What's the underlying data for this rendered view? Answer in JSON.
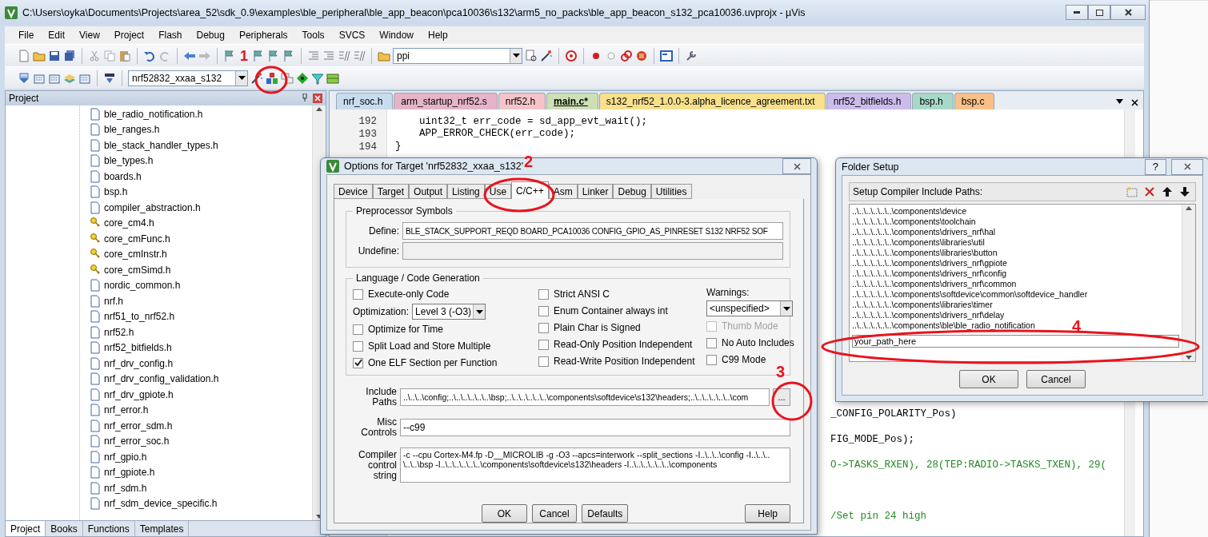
{
  "window": {
    "title": "C:\\Users\\oyka\\Documents\\Projects\\area_52\\sdk_0.9\\examples\\ble_peripheral\\ble_app_beacon\\pca10036\\s132\\arm5_no_packs\\ble_app_beacon_s132_pca10036.uvprojx - µVis"
  },
  "menu": [
    "File",
    "Edit",
    "View",
    "Project",
    "Flash",
    "Debug",
    "Peripherals",
    "Tools",
    "SVCS",
    "Window",
    "Help"
  ],
  "toolbar": {
    "find_combo": "ppi",
    "target_combo": "nrf52832_xxaa_s132"
  },
  "project_panel": {
    "title": "Project",
    "files": [
      {
        "name": "ble_radio_notification.h",
        "kind": "file"
      },
      {
        "name": "ble_ranges.h",
        "kind": "file"
      },
      {
        "name": "ble_stack_handler_types.h",
        "kind": "file"
      },
      {
        "name": "ble_types.h",
        "kind": "file"
      },
      {
        "name": "boards.h",
        "kind": "file"
      },
      {
        "name": "bsp.h",
        "kind": "file"
      },
      {
        "name": "compiler_abstraction.h",
        "kind": "file"
      },
      {
        "name": "core_cm4.h",
        "kind": "key"
      },
      {
        "name": "core_cmFunc.h",
        "kind": "key"
      },
      {
        "name": "core_cmInstr.h",
        "kind": "key"
      },
      {
        "name": "core_cmSimd.h",
        "kind": "key"
      },
      {
        "name": "nordic_common.h",
        "kind": "file"
      },
      {
        "name": "nrf.h",
        "kind": "file"
      },
      {
        "name": "nrf51_to_nrf52.h",
        "kind": "file"
      },
      {
        "name": "nrf52.h",
        "kind": "file"
      },
      {
        "name": "nrf52_bitfields.h",
        "kind": "file"
      },
      {
        "name": "nrf_drv_config.h",
        "kind": "file"
      },
      {
        "name": "nrf_drv_config_validation.h",
        "kind": "file"
      },
      {
        "name": "nrf_drv_gpiote.h",
        "kind": "file"
      },
      {
        "name": "nrf_error.h",
        "kind": "file"
      },
      {
        "name": "nrf_error_sdm.h",
        "kind": "file"
      },
      {
        "name": "nrf_error_soc.h",
        "kind": "file"
      },
      {
        "name": "nrf_gpio.h",
        "kind": "file"
      },
      {
        "name": "nrf_gpiote.h",
        "kind": "file"
      },
      {
        "name": "nrf_sdm.h",
        "kind": "file"
      },
      {
        "name": "nrf_sdm_device_specific.h",
        "kind": "file"
      }
    ],
    "tabs": [
      {
        "label": "Project",
        "selected": true
      },
      {
        "label": "Books",
        "selected": false
      },
      {
        "label": "Functions",
        "selected": false
      },
      {
        "label": "Templates",
        "selected": false
      }
    ]
  },
  "editor": {
    "tabs": [
      {
        "label": "nrf_soc.h",
        "selected": false,
        "color": "#c8dcf0"
      },
      {
        "label": "arm_startup_nrf52.s",
        "selected": false,
        "color": "#e6b4c8"
      },
      {
        "label": "nrf52.h",
        "selected": false,
        "color": "#f4c4c8"
      },
      {
        "label": "main.c*",
        "selected": true,
        "color": "#cce0b4"
      },
      {
        "label": "s132_nrf52_1.0.0-3.alpha_licence_agreement.txt",
        "selected": false,
        "color": "#f8e08c"
      },
      {
        "label": "nrf52_bitfields.h",
        "selected": false,
        "color": "#ccbcec"
      },
      {
        "label": "bsp.h",
        "selected": false,
        "color": "#a8d8c8"
      },
      {
        "label": "bsp.c",
        "selected": false,
        "color": "#f8c088"
      }
    ],
    "lines": [
      {
        "number": "192",
        "text": "    uint32_t err_code = sd_app_evt_wait();"
      },
      {
        "number": "193",
        "text": "    APP_ERROR_CHECK(err_code);"
      },
      {
        "number": "194",
        "text": "}"
      }
    ],
    "fragments": [
      {
        "text": "_CONFIG_POLARITY_Pos)",
        "kind": "code"
      },
      {
        "text": "FIG_MODE_Pos);",
        "kind": "code"
      },
      {
        "text": "O->TASKS_RXEN), 28(TEP:RADIO->TASKS_TXEN), 29(",
        "kind": "comment"
      },
      {
        "text": "/Set pin 24 high",
        "kind": "comment"
      }
    ]
  },
  "options_dialog": {
    "title": "Options for Target 'nrf52832_xxaa_s132'",
    "tabs": [
      {
        "label": "Device",
        "selected": false
      },
      {
        "label": "Target",
        "selected": false
      },
      {
        "label": "Output",
        "selected": false
      },
      {
        "label": "Listing",
        "selected": false
      },
      {
        "label": "Use",
        "selected": false
      },
      {
        "label": "C/C++",
        "selected": true
      },
      {
        "label": "Asm",
        "selected": false
      },
      {
        "label": "Linker",
        "selected": false
      },
      {
        "label": "Debug",
        "selected": false
      },
      {
        "label": "Utilities",
        "selected": false
      }
    ],
    "preprocessor": {
      "title": "Preprocessor Symbols",
      "define_label": "Define:",
      "define": "BLE_STACK_SUPPORT_REQD BOARD_PCA10036 CONFIG_GPIO_AS_PINRESET S132 NRF52 SOF",
      "undefine_label": "Undefine:"
    },
    "language": {
      "title": "Language / Code Generation",
      "column_1": [
        {
          "kind": "check",
          "label": "Execute-only Code",
          "checked": false,
          "disabled": false
        },
        {
          "kind": "select",
          "label": "Optimization:",
          "value": "Level 3 (-O3)"
        },
        {
          "kind": "check",
          "label": "Optimize for Time",
          "checked": false,
          "disabled": false
        },
        {
          "kind": "check",
          "label": "Split Load and Store Multiple",
          "checked": false,
          "disabled": false
        },
        {
          "kind": "check",
          "label": "One ELF Section per Function",
          "checked": true,
          "disabled": false
        }
      ],
      "column_2": [
        {
          "kind": "check",
          "label": "Strict ANSI C",
          "checked": false,
          "disabled": false
        },
        {
          "kind": "check",
          "label": "Enum Container always int",
          "checked": false,
          "disabled": false
        },
        {
          "kind": "check",
          "label": "Plain Char is Signed",
          "checked": false,
          "disabled": false
        },
        {
          "kind": "check",
          "label": "Read-Only Position Independent",
          "checked": false,
          "disabled": false
        },
        {
          "kind": "check",
          "label": "Read-Write Position Independent",
          "checked": false,
          "disabled": false
        }
      ],
      "warnings_label": "Warnings:",
      "warnings": "<unspecified>",
      "column_3": [
        {
          "kind": "check",
          "label": "Thumb Mode",
          "checked": false,
          "disabled": true
        },
        {
          "kind": "check",
          "label": "No Auto Includes",
          "checked": false,
          "disabled": false
        },
        {
          "kind": "check",
          "label": "C99 Mode",
          "checked": false,
          "disabled": false
        }
      ]
    },
    "include_label": "Include Paths",
    "include": "..\\..\\..\\config;..\\..\\..\\..\\..\\..\\bsp;..\\..\\..\\..\\..\\..\\components\\softdevice\\s132\\headers;..\\..\\..\\..\\..\\..\\com",
    "browse": "...",
    "misc_label": "Misc Controls",
    "misc": "--c99",
    "compiler_label": "Compiler control string",
    "compiler": [
      "-c --cpu Cortex-M4.fp -D__MICROLIB -g -O3 --apcs=interwork --split_sections -I..\\..\\..\\config -I..\\..\\..",
      "\\..\\..\\bsp -I..\\..\\..\\..\\..\\..\\components\\softdevice\\s132\\headers -I..\\..\\..\\..\\..\\..\\components"
    ],
    "buttons": [
      "OK",
      "Cancel",
      "Defaults",
      "Help"
    ]
  },
  "folder_dialog": {
    "title": "Folder Setup",
    "help": "?",
    "list_title": "Setup Compiler Include Paths:",
    "paths": [
      "..\\..\\..\\..\\..\\..\\components\\device",
      "..\\..\\..\\..\\..\\..\\components\\toolchain",
      "..\\..\\..\\..\\..\\..\\components\\drivers_nrf\\hal",
      "..\\..\\..\\..\\..\\..\\components\\libraries\\util",
      "..\\..\\..\\..\\..\\..\\components\\libraries\\button",
      "..\\..\\..\\..\\..\\..\\components\\drivers_nrf\\gpiote",
      "..\\..\\..\\..\\..\\..\\components\\drivers_nrf\\config",
      "..\\..\\..\\..\\..\\..\\components\\drivers_nrf\\common",
      "..\\..\\..\\..\\..\\..\\components\\softdevice\\common\\softdevice_handler",
      "..\\..\\..\\..\\..\\..\\components\\libraries\\timer",
      "..\\..\\..\\..\\..\\..\\components\\drivers_nrf\\delay",
      "..\\..\\..\\..\\..\\..\\components\\ble\\ble_radio_notification"
    ],
    "edit_value": "your_path_here",
    "buttons": [
      "OK",
      "Cancel"
    ]
  },
  "annotations": [
    "1",
    "2",
    "3",
    "4"
  ]
}
